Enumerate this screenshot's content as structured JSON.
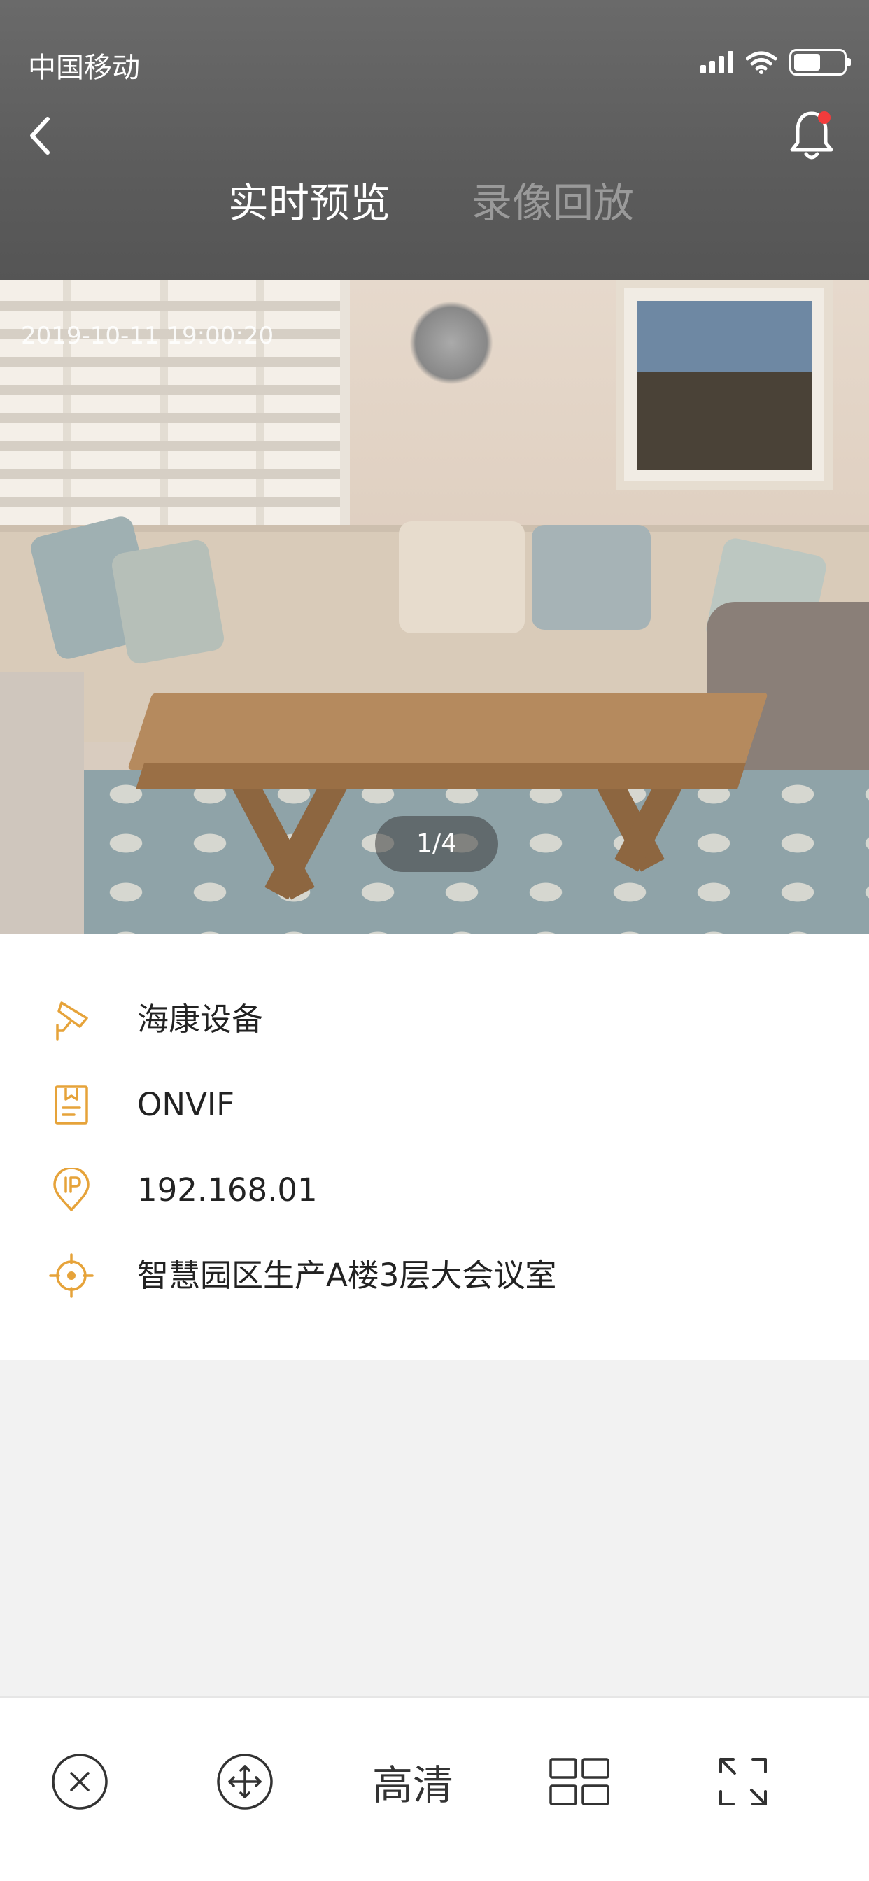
{
  "status_bar": {
    "carrier": "中国移动",
    "battery_level": 0.55,
    "icons": [
      "signal-icon",
      "wifi-icon",
      "battery-icon"
    ]
  },
  "nav": {
    "back_icon": "chevron-left-icon",
    "bell_icon": "bell-icon",
    "bell_badge_color": "#f23c3c"
  },
  "tabs": [
    {
      "label": "实时预览",
      "active": true
    },
    {
      "label": "录像回放",
      "active": false
    }
  ],
  "camera": {
    "timestamp": "2019-10-11  19:00:20",
    "pager": "1/4"
  },
  "device_info": {
    "accent_color": "#e6a33a",
    "items": [
      {
        "icon": "camera-icon",
        "text": "海康设备"
      },
      {
        "icon": "protocol-doc-icon",
        "text": "ONVIF"
      },
      {
        "icon": "ip-pin-icon",
        "text": "192.168.01"
      },
      {
        "icon": "location-target-icon",
        "text": "智慧园区生产A楼3层大会议室"
      }
    ]
  },
  "toolbar": {
    "close_icon": "close-circle-icon",
    "ptz_icon": "ptz-move-icon",
    "quality_label": "高清",
    "grid_icon": "grid-layout-icon",
    "fullscreen_icon": "fullscreen-icon"
  }
}
